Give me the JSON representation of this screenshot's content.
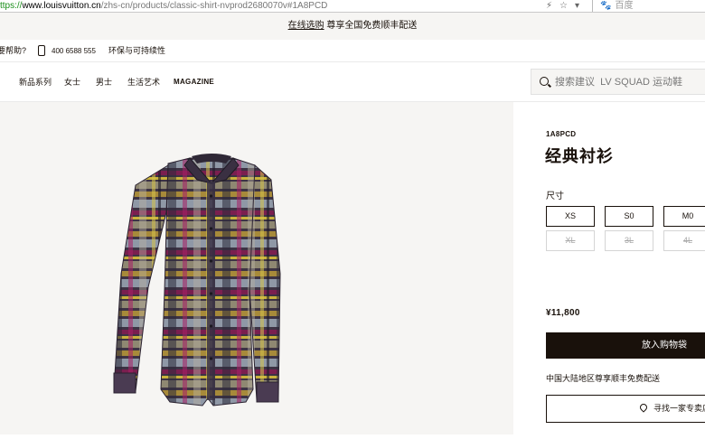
{
  "browser": {
    "url_protocol": "ttps://",
    "url_host": "www.louisvuitton.cn",
    "url_path": "/zhs-cn/products/classic-shirt-nvprod2680070v#1A8PCD",
    "search_engine": "百度"
  },
  "promo": {
    "link": "在线选购",
    "text": " 尊享全国免费顺丰配送"
  },
  "utility": {
    "help": "要帮助?",
    "phone": "400 6588 555",
    "sustainability": "环保与可持续性"
  },
  "nav": {
    "items": [
      "新品系列",
      "女士",
      "男士",
      "生活艺术"
    ],
    "magazine": "MAGAZINE",
    "search_placeholder": "搜索建议  LV SQUAD 运动鞋"
  },
  "product": {
    "sku": "1A8PCD",
    "title": "经典衬衫",
    "size_label": "尺寸",
    "sizes": [
      "XS",
      "S0",
      "M0",
      "XL",
      "3L",
      "4L"
    ],
    "sizes_unavailable": [
      "XL",
      "3L",
      "4L"
    ],
    "price": "¥11,800",
    "add_to_cart": "放入购物袋",
    "shipping_note": "中国大陆地区尊享顺丰免费配送",
    "find_store": "寻找一家专卖店"
  },
  "colors": {
    "ink": "#19110b",
    "banner_bg": "#f6f5f3"
  }
}
